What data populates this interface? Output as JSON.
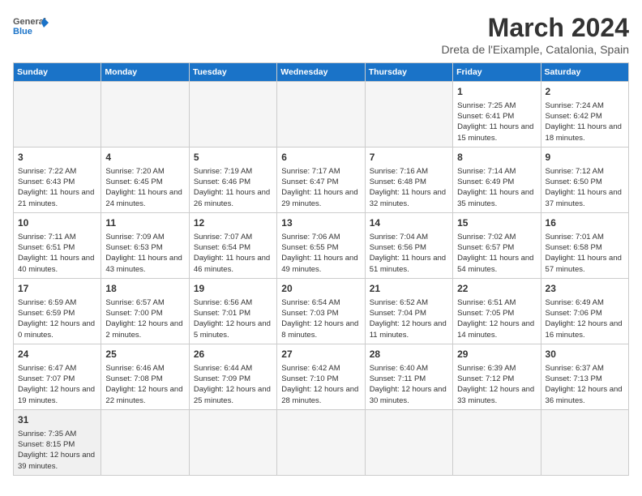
{
  "header": {
    "logo_general": "General",
    "logo_blue": "Blue",
    "month_year": "March 2024",
    "location": "Dreta de l'Eixample, Catalonia, Spain"
  },
  "weekdays": [
    "Sunday",
    "Monday",
    "Tuesday",
    "Wednesday",
    "Thursday",
    "Friday",
    "Saturday"
  ],
  "weeks": [
    [
      {
        "day": "",
        "info": ""
      },
      {
        "day": "",
        "info": ""
      },
      {
        "day": "",
        "info": ""
      },
      {
        "day": "",
        "info": ""
      },
      {
        "day": "",
        "info": ""
      },
      {
        "day": "1",
        "info": "Sunrise: 7:25 AM\nSunset: 6:41 PM\nDaylight: 11 hours and 15 minutes."
      },
      {
        "day": "2",
        "info": "Sunrise: 7:24 AM\nSunset: 6:42 PM\nDaylight: 11 hours and 18 minutes."
      }
    ],
    [
      {
        "day": "3",
        "info": "Sunrise: 7:22 AM\nSunset: 6:43 PM\nDaylight: 11 hours and 21 minutes."
      },
      {
        "day": "4",
        "info": "Sunrise: 7:20 AM\nSunset: 6:45 PM\nDaylight: 11 hours and 24 minutes."
      },
      {
        "day": "5",
        "info": "Sunrise: 7:19 AM\nSunset: 6:46 PM\nDaylight: 11 hours and 26 minutes."
      },
      {
        "day": "6",
        "info": "Sunrise: 7:17 AM\nSunset: 6:47 PM\nDaylight: 11 hours and 29 minutes."
      },
      {
        "day": "7",
        "info": "Sunrise: 7:16 AM\nSunset: 6:48 PM\nDaylight: 11 hours and 32 minutes."
      },
      {
        "day": "8",
        "info": "Sunrise: 7:14 AM\nSunset: 6:49 PM\nDaylight: 11 hours and 35 minutes."
      },
      {
        "day": "9",
        "info": "Sunrise: 7:12 AM\nSunset: 6:50 PM\nDaylight: 11 hours and 37 minutes."
      }
    ],
    [
      {
        "day": "10",
        "info": "Sunrise: 7:11 AM\nSunset: 6:51 PM\nDaylight: 11 hours and 40 minutes."
      },
      {
        "day": "11",
        "info": "Sunrise: 7:09 AM\nSunset: 6:53 PM\nDaylight: 11 hours and 43 minutes."
      },
      {
        "day": "12",
        "info": "Sunrise: 7:07 AM\nSunset: 6:54 PM\nDaylight: 11 hours and 46 minutes."
      },
      {
        "day": "13",
        "info": "Sunrise: 7:06 AM\nSunset: 6:55 PM\nDaylight: 11 hours and 49 minutes."
      },
      {
        "day": "14",
        "info": "Sunrise: 7:04 AM\nSunset: 6:56 PM\nDaylight: 11 hours and 51 minutes."
      },
      {
        "day": "15",
        "info": "Sunrise: 7:02 AM\nSunset: 6:57 PM\nDaylight: 11 hours and 54 minutes."
      },
      {
        "day": "16",
        "info": "Sunrise: 7:01 AM\nSunset: 6:58 PM\nDaylight: 11 hours and 57 minutes."
      }
    ],
    [
      {
        "day": "17",
        "info": "Sunrise: 6:59 AM\nSunset: 6:59 PM\nDaylight: 12 hours and 0 minutes."
      },
      {
        "day": "18",
        "info": "Sunrise: 6:57 AM\nSunset: 7:00 PM\nDaylight: 12 hours and 2 minutes."
      },
      {
        "day": "19",
        "info": "Sunrise: 6:56 AM\nSunset: 7:01 PM\nDaylight: 12 hours and 5 minutes."
      },
      {
        "day": "20",
        "info": "Sunrise: 6:54 AM\nSunset: 7:03 PM\nDaylight: 12 hours and 8 minutes."
      },
      {
        "day": "21",
        "info": "Sunrise: 6:52 AM\nSunset: 7:04 PM\nDaylight: 12 hours and 11 minutes."
      },
      {
        "day": "22",
        "info": "Sunrise: 6:51 AM\nSunset: 7:05 PM\nDaylight: 12 hours and 14 minutes."
      },
      {
        "day": "23",
        "info": "Sunrise: 6:49 AM\nSunset: 7:06 PM\nDaylight: 12 hours and 16 minutes."
      }
    ],
    [
      {
        "day": "24",
        "info": "Sunrise: 6:47 AM\nSunset: 7:07 PM\nDaylight: 12 hours and 19 minutes."
      },
      {
        "day": "25",
        "info": "Sunrise: 6:46 AM\nSunset: 7:08 PM\nDaylight: 12 hours and 22 minutes."
      },
      {
        "day": "26",
        "info": "Sunrise: 6:44 AM\nSunset: 7:09 PM\nDaylight: 12 hours and 25 minutes."
      },
      {
        "day": "27",
        "info": "Sunrise: 6:42 AM\nSunset: 7:10 PM\nDaylight: 12 hours and 28 minutes."
      },
      {
        "day": "28",
        "info": "Sunrise: 6:40 AM\nSunset: 7:11 PM\nDaylight: 12 hours and 30 minutes."
      },
      {
        "day": "29",
        "info": "Sunrise: 6:39 AM\nSunset: 7:12 PM\nDaylight: 12 hours and 33 minutes."
      },
      {
        "day": "30",
        "info": "Sunrise: 6:37 AM\nSunset: 7:13 PM\nDaylight: 12 hours and 36 minutes."
      }
    ],
    [
      {
        "day": "31",
        "info": "Sunrise: 7:35 AM\nSunset: 8:15 PM\nDaylight: 12 hours and 39 minutes."
      },
      {
        "day": "",
        "info": ""
      },
      {
        "day": "",
        "info": ""
      },
      {
        "day": "",
        "info": ""
      },
      {
        "day": "",
        "info": ""
      },
      {
        "day": "",
        "info": ""
      },
      {
        "day": "",
        "info": ""
      }
    ]
  ]
}
